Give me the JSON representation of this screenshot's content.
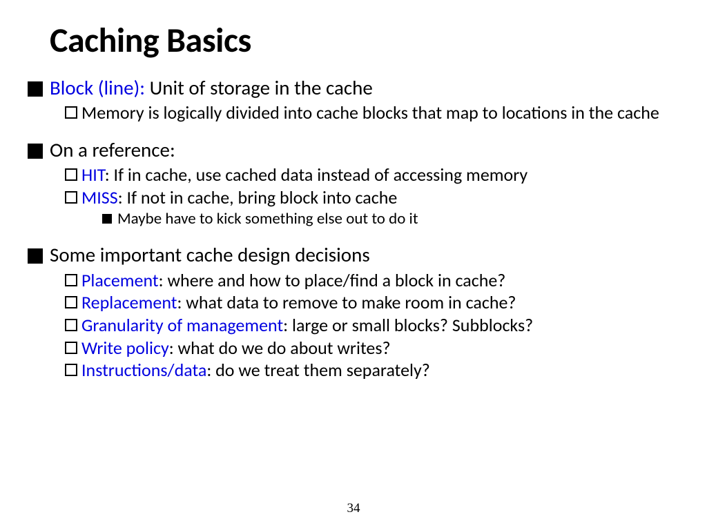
{
  "title": "Caching Basics",
  "pagenum": "34",
  "b1": {
    "term": "Block (line):",
    "rest": " Unit of storage in the cache",
    "sub1": "Memory is logically divided into cache blocks that map to locations in the cache"
  },
  "b2": {
    "text": "On a reference:",
    "hit_term": "HIT",
    "hit_rest": ": If in cache, use cached data instead of accessing memory",
    "miss_term": "MISS",
    "miss_rest": ": If not in cache, bring block into cache",
    "miss_sub": "Maybe have to kick something else out to do it"
  },
  "b3": {
    "text": "Some important cache design decisions",
    "p1_term": "Placement",
    "p1_rest": ": where and how to place/find a block in cache?",
    "p2_term": "Replacement",
    "p2_rest": ": what data to remove to make room in cache?",
    "p3_term": "Granularity of management",
    "p3_rest": ": large or small blocks? Subblocks?",
    "p4_term": "Write policy",
    "p4_rest": ": what do we do about writes?",
    "p5_term": "Instructions/data",
    "p5_rest": ": do we treat them separately?"
  }
}
